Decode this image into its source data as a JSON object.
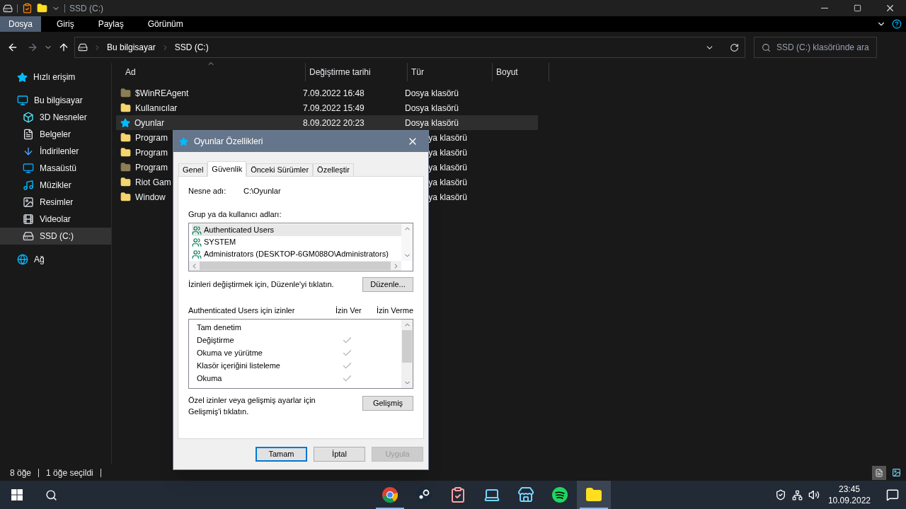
{
  "window": {
    "title": "SSD (C:)"
  },
  "ribbon_tabs": [
    {
      "label": "Dosya",
      "selected": true
    },
    {
      "label": "Giriş",
      "selected": false
    },
    {
      "label": "Paylaş",
      "selected": false
    },
    {
      "label": "Görünüm",
      "selected": false
    }
  ],
  "address": {
    "breadcrumbs": [
      "Bu bilgisayar",
      "SSD (C:)"
    ],
    "search_placeholder": "SSD (C:) klasöründe ara"
  },
  "sidebar": {
    "items": [
      {
        "label": "Hızlı erişim",
        "selected": false
      },
      {
        "label": "Bu bilgisayar",
        "selected": false,
        "children": [
          {
            "label": "3D Nesneler",
            "selected": false
          },
          {
            "label": "Belgeler",
            "selected": false
          },
          {
            "label": "İndirilenler",
            "selected": false
          },
          {
            "label": "Masaüstü",
            "selected": false
          },
          {
            "label": "Müzikler",
            "selected": false
          },
          {
            "label": "Resimler",
            "selected": false
          },
          {
            "label": "Videolar",
            "selected": false
          },
          {
            "label": "SSD (C:)",
            "selected": true
          }
        ]
      },
      {
        "label": "Ağ",
        "selected": false
      }
    ]
  },
  "table": {
    "columns": [
      "Ad",
      "Değiştirme tarihi",
      "Tür",
      "Boyut"
    ],
    "rows": [
      {
        "name": "$WinREAgent",
        "date": "7.09.2022 16:48",
        "type": "Dosya klasörü",
        "hidden": true,
        "pinned": false,
        "selected": false
      },
      {
        "name": "Kullanıcılar",
        "date": "7.09.2022 15:49",
        "type": "Dosya klasörü",
        "hidden": false,
        "pinned": false,
        "selected": false
      },
      {
        "name": "Oyunlar",
        "date": "8.09.2022 20:23",
        "type": "Dosya klasörü",
        "hidden": false,
        "pinned": true,
        "selected": true
      },
      {
        "name": "Program",
        "type": "ya klasörü",
        "hidden": false,
        "pinned": false,
        "selected": false
      },
      {
        "name": "Program",
        "type": "ya klasörü",
        "hidden": false,
        "pinned": false,
        "selected": false
      },
      {
        "name": "Program",
        "type": "ya klasörü",
        "hidden": true,
        "pinned": false,
        "selected": false
      },
      {
        "name": "Riot Gam",
        "type": "ya klasörü",
        "hidden": false,
        "pinned": false,
        "selected": false
      },
      {
        "name": "Window",
        "type": "ya klasörü",
        "hidden": false,
        "pinned": false,
        "selected": false
      }
    ]
  },
  "status_bar": [
    "8 öğe",
    "1 öğe seçildi"
  ],
  "dialog": {
    "title": "Oyunlar Özellikleri",
    "tabs": [
      {
        "label": "Genel",
        "selected": false
      },
      {
        "label": "Güvenlik",
        "selected": true
      },
      {
        "label": "Önceki Sürümler",
        "selected": false
      },
      {
        "label": "Özelleştir",
        "selected": false
      }
    ],
    "object_label": "Nesne adı:",
    "object_value": "C:\\Oyunlar",
    "group_label": "Grup ya da kullanıcı adları:",
    "principals": [
      {
        "name": "Authenticated Users",
        "selected": true
      },
      {
        "name": "SYSTEM",
        "selected": false
      },
      {
        "name": "Administrators (DESKTOP-6GM088O\\Administrators)",
        "selected": false
      }
    ],
    "edit_hint": "İzinleri değiştirmek için, Düzenle'yi tıklatın.",
    "edit_button": "Düzenle...",
    "permissions_label": "Authenticated Users için izinler",
    "allow_header": "İzin Ver",
    "deny_header": "İzin Verme",
    "permissions": [
      {
        "name": "Tam denetim",
        "allow": false,
        "deny": false
      },
      {
        "name": "Değiştirme",
        "allow": true,
        "deny": false
      },
      {
        "name": "Okuma ve yürütme",
        "allow": true,
        "deny": false
      },
      {
        "name": "Klasör içeriğini listeleme",
        "allow": true,
        "deny": false
      },
      {
        "name": "Okuma",
        "allow": true,
        "deny": false
      }
    ],
    "advanced_hint": "Özel izinler veya gelişmiş ayarlar için Gelişmiş'i tıklatın.",
    "advanced_button": "Gelişmiş",
    "buttons": [
      {
        "label": "Tamam",
        "default": true,
        "disabled": false
      },
      {
        "label": "İptal",
        "default": false,
        "disabled": false
      },
      {
        "label": "Uygula",
        "default": false,
        "disabled": true
      }
    ]
  },
  "taskbar": {
    "apps": [
      {
        "running": true,
        "active": false
      },
      {
        "running": false,
        "active": false
      },
      {
        "running": false,
        "active": false
      },
      {
        "running": false,
        "active": false
      },
      {
        "running": false,
        "active": false
      },
      {
        "running": false,
        "active": false
      },
      {
        "running": true,
        "active": true
      }
    ],
    "time": "23:45",
    "date": "10.09.2022"
  }
}
